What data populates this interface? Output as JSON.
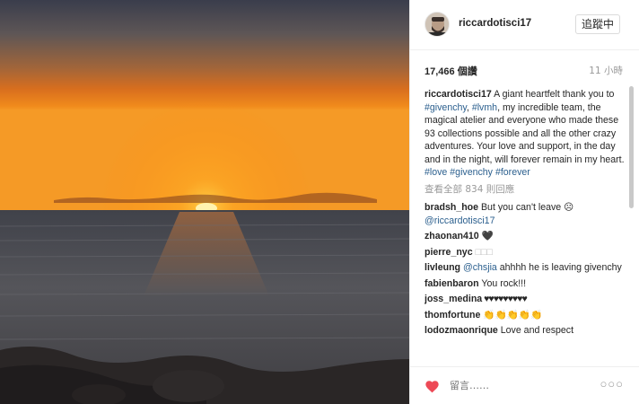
{
  "post": {
    "username": "riccardotisci17",
    "follow_label": "追蹤中",
    "views": "17,466 個讚",
    "time": "11 小時"
  },
  "caption": {
    "user": "riccardotisci17",
    "text_1": " A giant heartfelt thank you to ",
    "tag_1": "#givenchy",
    "sep_1": ", ",
    "tag_2": "#lvmh",
    "text_2": ", my incredible team, the magical atelier and everyone who made these 93 collections possible and all the other crazy adventures. Your love and support, in the day and in the night, will forever remain in my heart. ",
    "tag_3": "#love",
    "sep_2": " ",
    "tag_4": "#givenchy",
    "sep_3": " ",
    "tag_5": "#forever"
  },
  "view_all": "查看全部 834 則回應",
  "comments": [
    {
      "user": "bradsh_hoe",
      "text": " But you can't leave ☹ ",
      "mention": "@riccardotisci17"
    },
    {
      "user": "zhaonan410",
      "text": " 🖤"
    },
    {
      "user": "pierre_nyc",
      "text": " □□□"
    },
    {
      "user": "livleung",
      "text": " ahhhh he is leaving givenchy",
      "mention": "@chsjia"
    },
    {
      "user": "fabienbaron",
      "text": " You rock!!!"
    },
    {
      "user": "joss_medina",
      "text": " ♥♥♥♥♥♥♥♥♥"
    },
    {
      "user": "thomfortune",
      "text": " 👏👏👏👏👏"
    },
    {
      "user": "lodozmaonrique",
      "text": " Love and respect"
    }
  ],
  "footer": {
    "comment_placeholder": "留言……",
    "more_label": "○○○"
  },
  "colors": {
    "link": "#2b5f8e",
    "heart": "#ed4956",
    "muted": "#999999"
  },
  "icons": {
    "like": "heart-icon",
    "more": "more-options-icon"
  }
}
